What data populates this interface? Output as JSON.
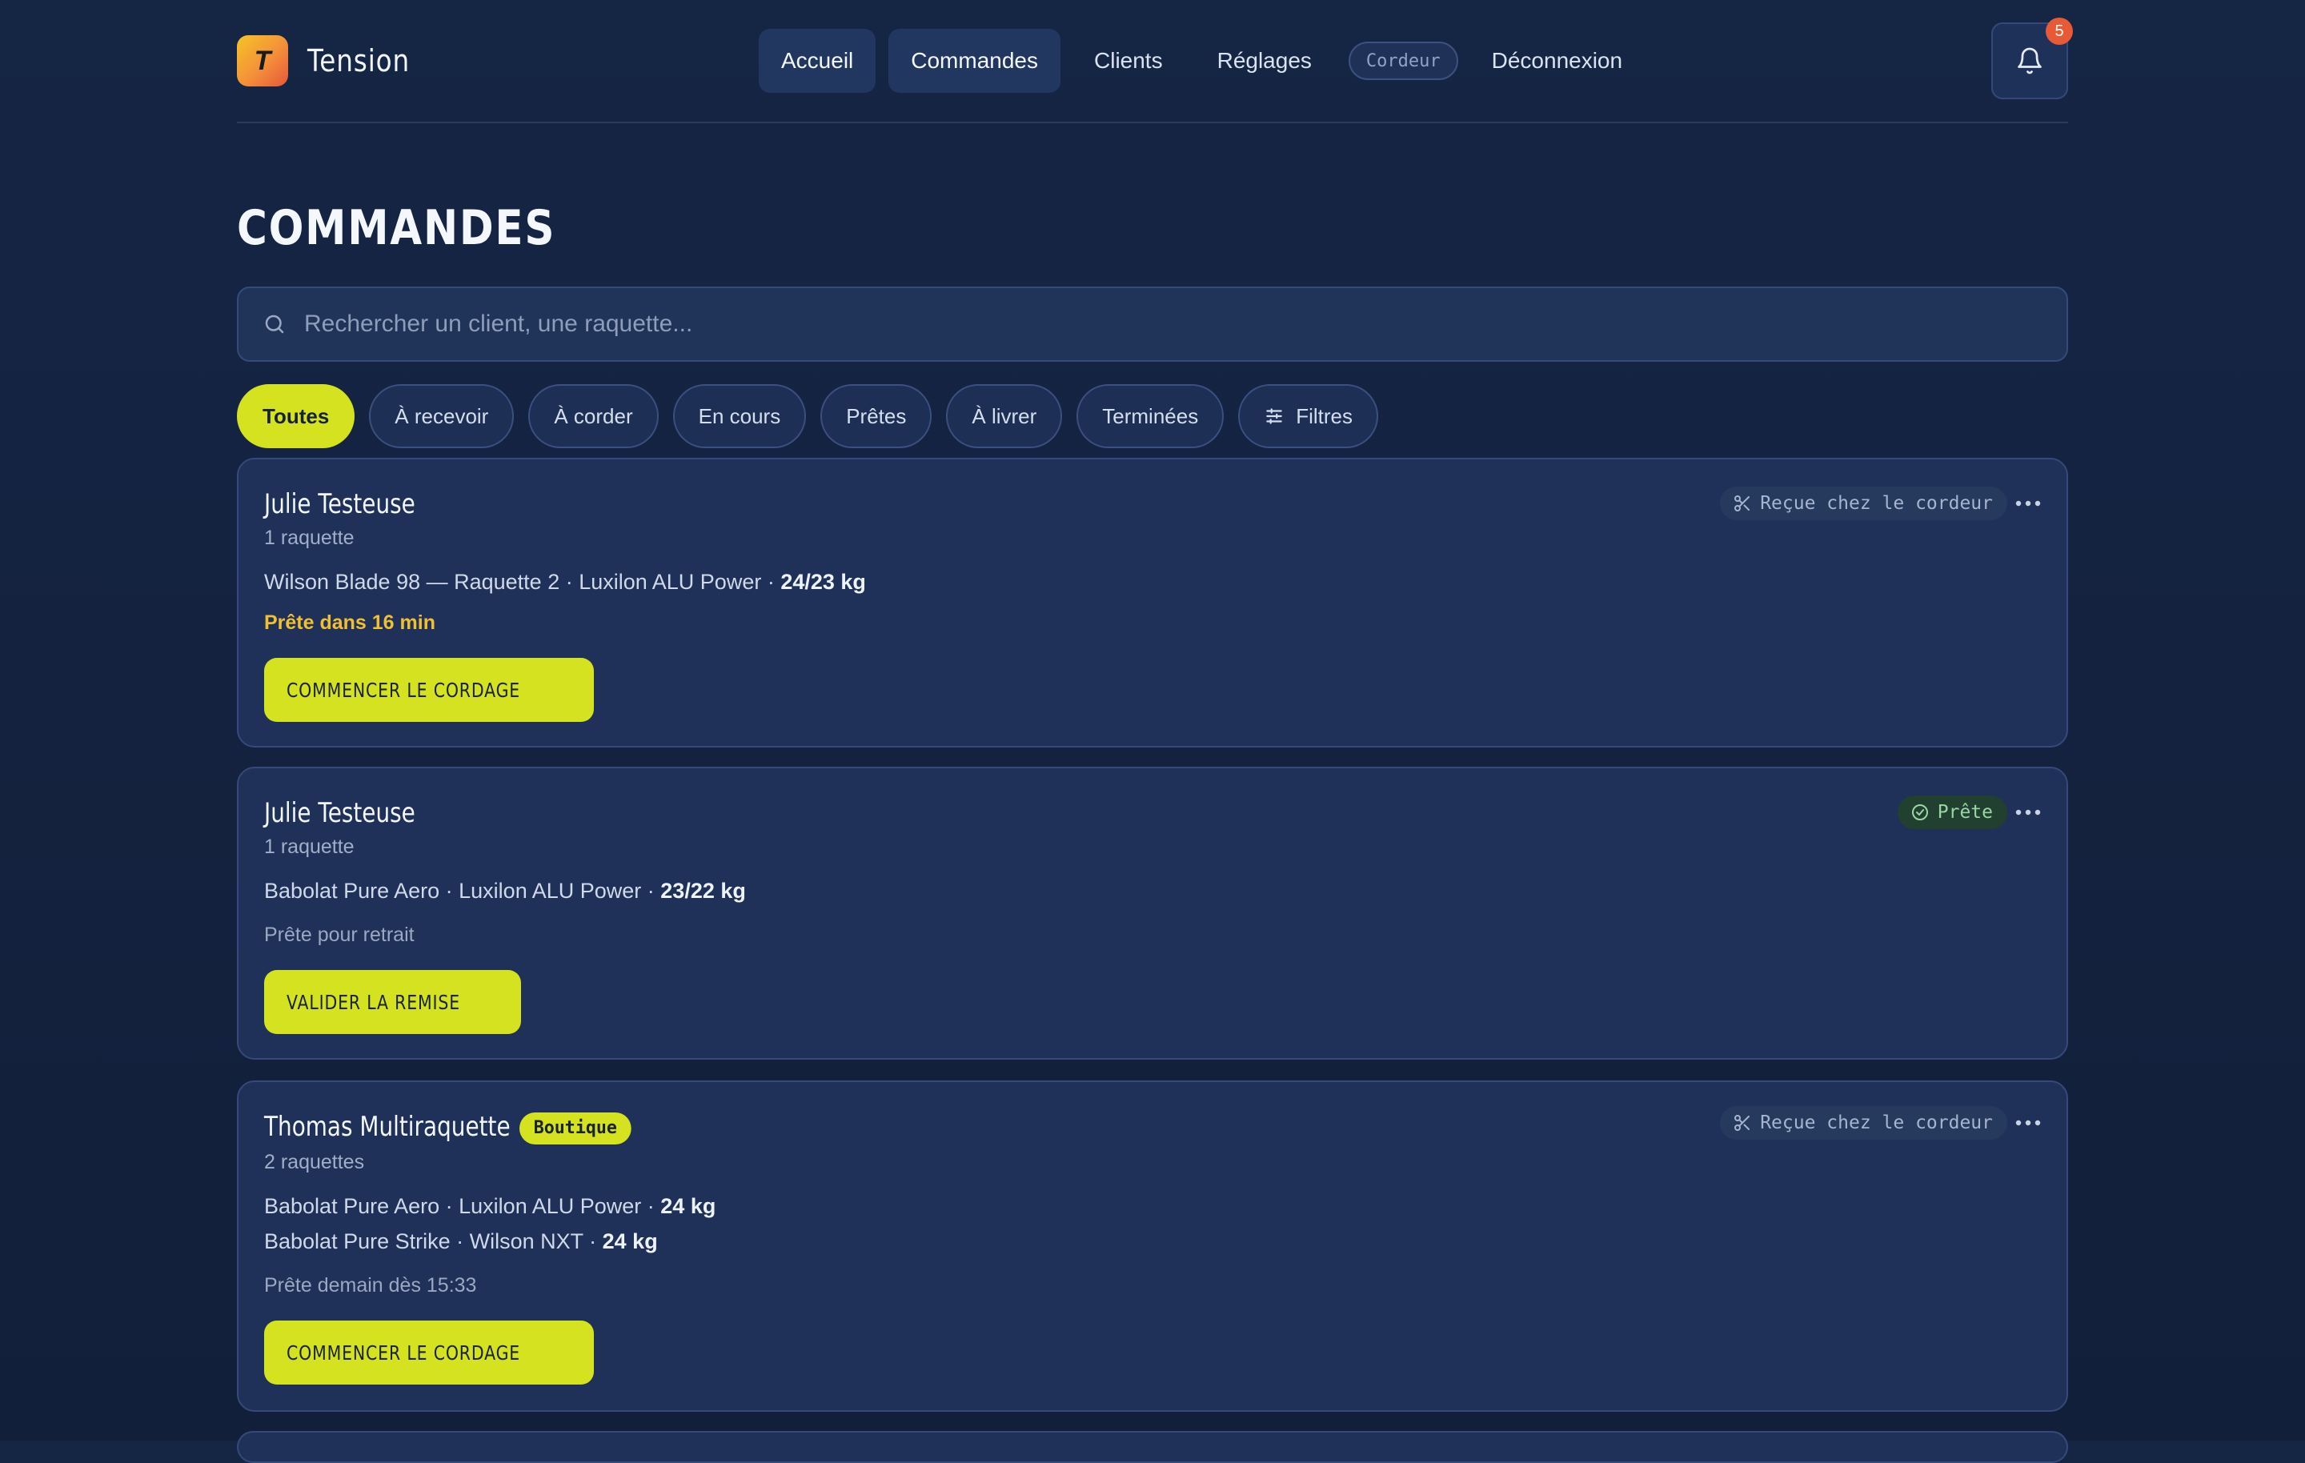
{
  "brand": {
    "name": "Tension",
    "logo_letter": "T"
  },
  "nav": {
    "items": [
      {
        "label": "Accueil",
        "active": true
      },
      {
        "label": "Commandes",
        "active": true
      },
      {
        "label": "Clients",
        "active": false
      },
      {
        "label": "Réglages",
        "active": false
      }
    ],
    "role": "Cordeur",
    "logout": "Déconnexion",
    "notifications": "5"
  },
  "page": {
    "title": "COMMANDES"
  },
  "search": {
    "placeholder": "Rechercher un client, une raquette..."
  },
  "filters": {
    "chips": [
      "Toutes",
      "À recevoir",
      "À corder",
      "En cours",
      "Prêtes",
      "À livrer",
      "Terminées"
    ],
    "more": "Filtres"
  },
  "orders": [
    {
      "client": "Julie Testeuse",
      "count": "1 raquette",
      "lines": [
        {
          "text": "Wilson Blade 98 — Raquette 2 · Luxilon ALU Power · ",
          "tension": "24/23 kg"
        }
      ],
      "eta": "Prête dans 16 min",
      "status": "Reçue chez le cordeur",
      "action": "COMMENCER LE CORDAGE"
    },
    {
      "client": "Julie Testeuse",
      "count": "1 raquette",
      "lines": [
        {
          "text": "Babolat Pure Aero · Luxilon ALU Power · ",
          "tension": "23/22 kg"
        }
      ],
      "eta": "Prête pour retrait",
      "status": "Prête",
      "action": "VALIDER LA REMISE"
    },
    {
      "client": "Thomas Multiraquette",
      "tag": "Boutique",
      "count": "2 raquettes",
      "lines": [
        {
          "text": "Babolat Pure Aero · Luxilon ALU Power · ",
          "tension": "24 kg"
        },
        {
          "text": "Babolat Pure Strike · Wilson NXT · ",
          "tension": "24 kg"
        }
      ],
      "eta": "Prête demain dès 15:33",
      "status": "Reçue chez le cordeur",
      "action": "COMMENCER LE CORDAGE"
    }
  ],
  "colors": {
    "accent": "#d4e21f",
    "background": "#14223f",
    "card": "#1f3158",
    "warning": "#f0c030",
    "badge": "#e85a36"
  }
}
